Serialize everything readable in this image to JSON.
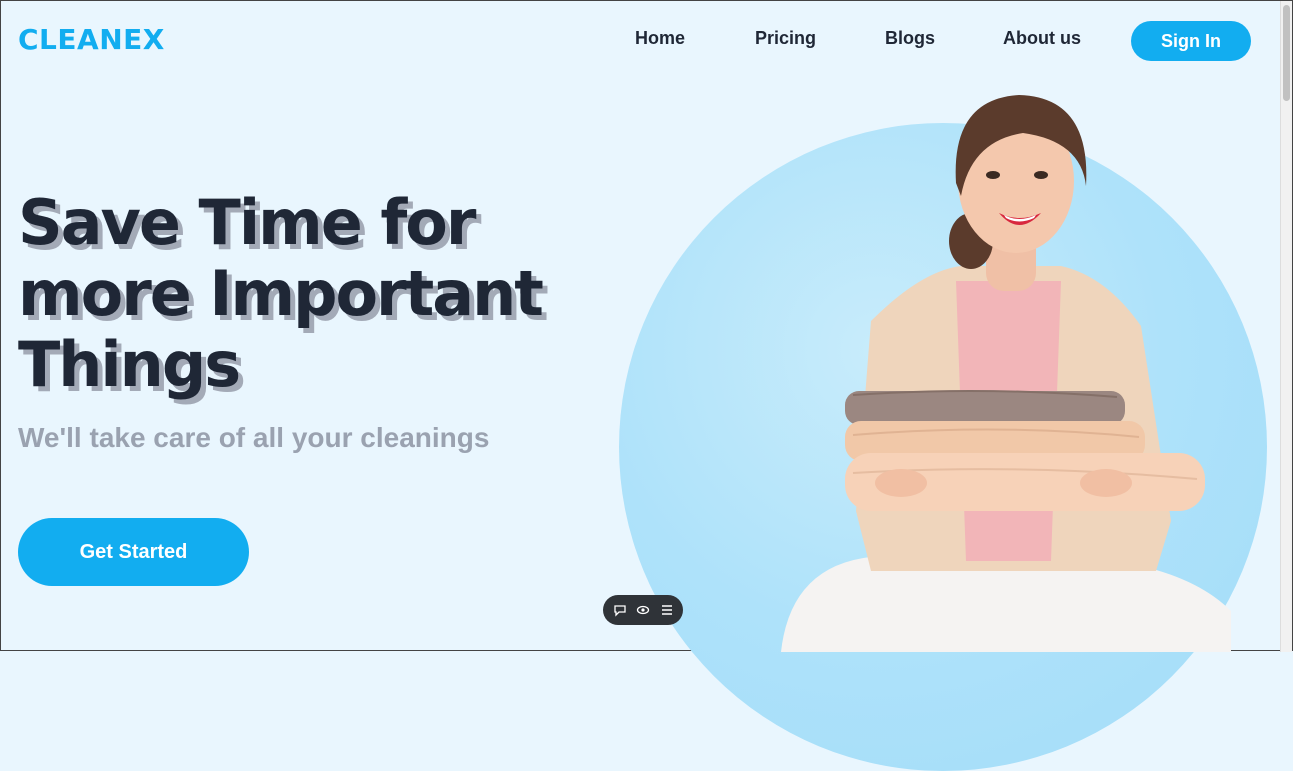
{
  "brand": {
    "name": "CLEANEX",
    "color": "#12adf0"
  },
  "nav": {
    "home": "Home",
    "pricing": "Pricing",
    "blogs": "Blogs",
    "about": "About us",
    "sign_in": "Sign In"
  },
  "hero": {
    "title_lines": [
      "Save Time for",
      "more Important",
      "Things"
    ],
    "subtitle": "We'll take care of all your cleanings",
    "cta": "Get Started",
    "image": "woman-holding-folded-sweaters"
  },
  "toolbar": {
    "icons": [
      "chat-icon",
      "eye-icon",
      "list-icon"
    ]
  }
}
